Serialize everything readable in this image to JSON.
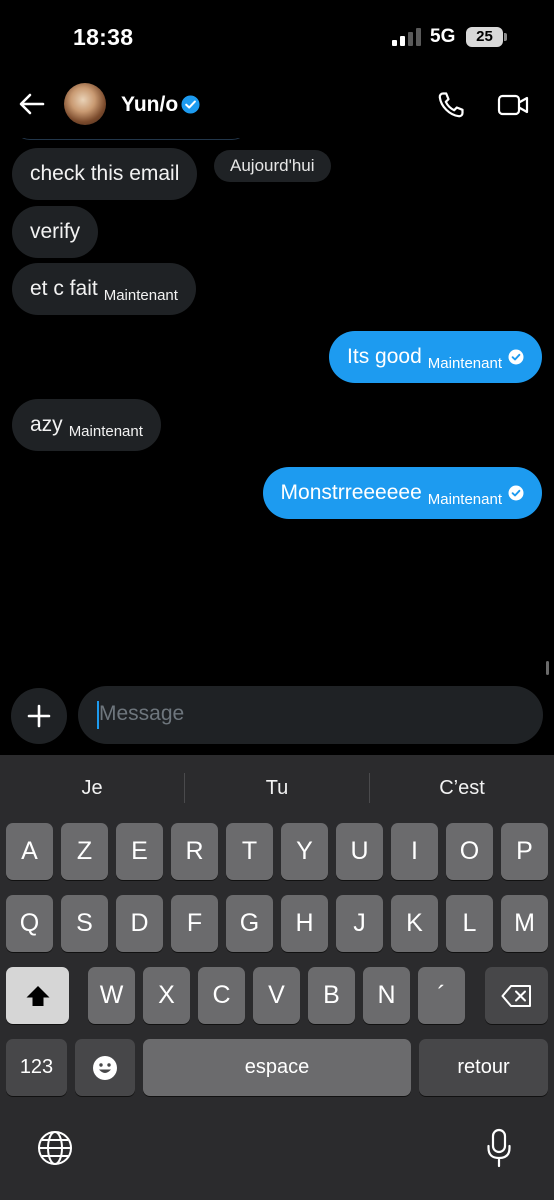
{
  "status_bar": {
    "time": "18:38",
    "network": "5G",
    "battery": "25"
  },
  "header": {
    "contact_name": "Yun/o"
  },
  "messages": [
    {
      "text": "check this email",
      "time": "",
      "direction": "in"
    },
    {
      "text": "verify",
      "time": "",
      "direction": "in"
    },
    {
      "text": "et c fait",
      "time": "Maintenant",
      "direction": "in"
    },
    {
      "text": "Its good",
      "time": "Maintenant",
      "direction": "out"
    },
    {
      "text": "azy",
      "time": "Maintenant",
      "direction": "in"
    },
    {
      "text": "Monstrreeeeee",
      "time": "Maintenant",
      "direction": "out"
    }
  ],
  "day_separator": "Aujourd'hui",
  "composer": {
    "placeholder": "Message"
  },
  "keyboard": {
    "suggestions": [
      "Je",
      "Tu",
      "C’est"
    ],
    "row1": [
      "A",
      "Z",
      "E",
      "R",
      "T",
      "Y",
      "U",
      "I",
      "O",
      "P"
    ],
    "row2": [
      "Q",
      "S",
      "D",
      "F",
      "G",
      "H",
      "J",
      "K",
      "L",
      "M"
    ],
    "row3": [
      "W",
      "X",
      "C",
      "V",
      "B",
      "N",
      "´"
    ],
    "numbers_label": "123",
    "space_label": "espace",
    "return_label": "retour"
  },
  "colors": {
    "accent": "#1d9bf0",
    "incoming_bubble": "#1f2225",
    "keyboard_bg": "#2b2b2d",
    "key_bg": "#6b6b6d"
  }
}
